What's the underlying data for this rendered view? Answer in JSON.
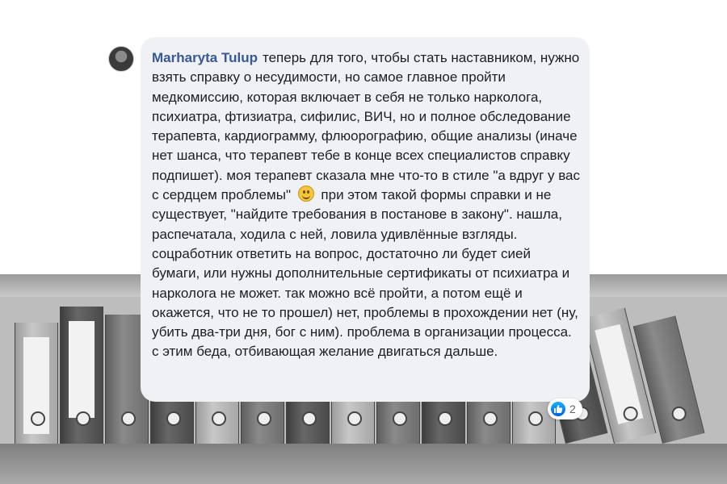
{
  "comment": {
    "author": "Marharyta Tulup",
    "text_before_emoji": "теперь для того, чтобы стать наставником, нужно взять справку о несудимости, но самое главное пройти медкомиссию, которая включает в себя не только нарколога, психиатра, фтизиатра, сифилис, ВИЧ, но и полное обследование терапевта, кардиограмму, флюорографию, общие анализы (иначе нет шанса, что терапевт тебе в конце всех специалистов справку подпишет). моя терапевт сказала мне что-то в стиле \"а вдруг у вас с сердцем проблемы\"",
    "emoji": "smiling-face-icon",
    "text_after_emoji": "при этом такой формы справки и не существует, \"найдите требования в постанове в закону\". нашла, распечатала, ходила с ней, ловила удивлённые взгляды. соцработник ответить на вопрос, достаточно ли будет сией бумаги, или нужны дополнительные сертификаты от психиатра и нарколога не может. так можно всё пройти, а потом ещё и окажется, что не то прошел) нет, проблемы в прохождении нет (ну, убить два-три дня, бог с ним). проблема в организации процесса. с этим беда, отбивающая желание двигаться дальше.",
    "reactions": {
      "icon": "like-icon",
      "count": "2"
    }
  },
  "colors": {
    "author_link": "#385898",
    "bubble_bg": "#eff1f5",
    "text": "#1c1e21",
    "like_blue": "#1877f2"
  }
}
